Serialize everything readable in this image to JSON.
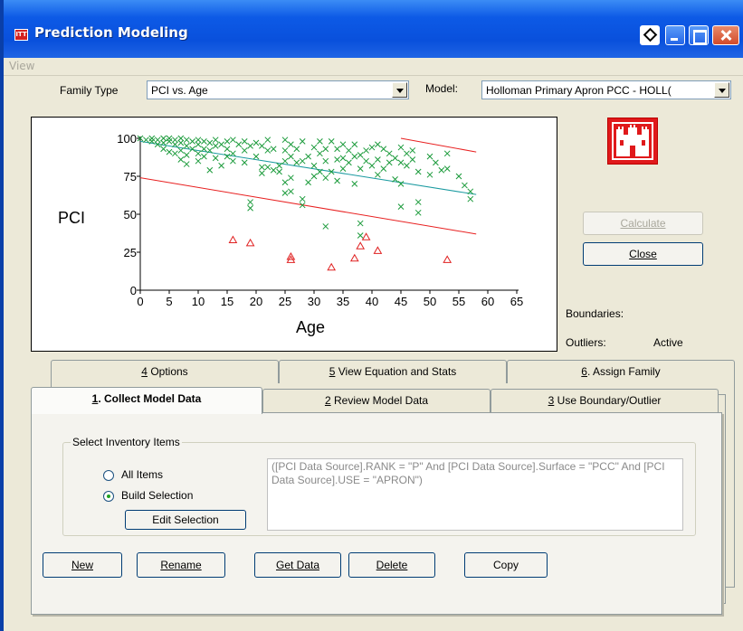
{
  "window": {
    "title": "Prediction Modeling"
  },
  "menu": {
    "view": "View"
  },
  "family": {
    "label": "Family Type",
    "value": "PCI vs. Age"
  },
  "model": {
    "label": "Model:",
    "value": "Holloman Primary Apron PCC - HOLL("
  },
  "buttons": {
    "calculate": "Calculate",
    "close": "Close",
    "edit_selection": "Edit Selection",
    "new": "New",
    "rename": "Rename",
    "get_data": "Get Data",
    "delete": "Delete",
    "copy": "Copy"
  },
  "status": {
    "boundaries_label": "Boundaries:",
    "outliers_label": "Outliers:",
    "outliers_value": "Active"
  },
  "tabs": {
    "back": [
      {
        "num": "4",
        "label": " Options"
      },
      {
        "num": "5",
        "label": " View Equation and Stats"
      },
      {
        "num": "6",
        "label": ". Assign Family"
      }
    ],
    "front": [
      {
        "num": "1",
        "label": ". Collect Model Data"
      },
      {
        "num": "2",
        "label": " Review Model Data"
      },
      {
        "num": "3",
        "label": " Use Boundary/Outlier"
      }
    ]
  },
  "inventory": {
    "legend": "Select Inventory Items",
    "option_all": "All Items",
    "option_build": "Build Selection",
    "query": "([PCI Data Source].RANK = \"P\" And [PCI Data Source].Surface = \"PCC\" And [PCI Data Source].USE = \"APRON\")"
  },
  "colors": {
    "title_blue": "#0950dc",
    "point_green": "#1a9a3a",
    "outlier_red": "#e02020",
    "fit_teal": "#1a9aa0",
    "boundary_red": "#e82020",
    "logo_red": "#e0191b"
  },
  "chart_data": {
    "type": "scatter",
    "xlabel": "Age",
    "ylabel": "PCI",
    "xlim": [
      0,
      65
    ],
    "ylim": [
      0,
      100
    ],
    "x_ticks": [
      0,
      5,
      10,
      15,
      20,
      25,
      30,
      35,
      40,
      45,
      50,
      55,
      60,
      65
    ],
    "y_ticks": [
      0,
      25,
      50,
      75,
      100
    ],
    "grid": false,
    "series": [
      {
        "marker": "x",
        "color": "#1a9a3a",
        "points": [
          [
            0,
            100
          ],
          [
            1,
            99
          ],
          [
            2,
            100
          ],
          [
            2,
            98
          ],
          [
            3,
            99
          ],
          [
            3,
            96
          ],
          [
            4,
            100
          ],
          [
            4,
            97
          ],
          [
            4,
            93
          ],
          [
            5,
            100
          ],
          [
            5,
            98
          ],
          [
            5,
            91
          ],
          [
            6,
            99
          ],
          [
            6,
            96
          ],
          [
            6,
            90
          ],
          [
            7,
            100
          ],
          [
            7,
            97
          ],
          [
            7,
            92
          ],
          [
            7,
            86
          ],
          [
            8,
            99
          ],
          [
            8,
            95
          ],
          [
            8,
            89
          ],
          [
            8,
            83
          ],
          [
            9,
            98
          ],
          [
            9,
            93
          ],
          [
            10,
            99
          ],
          [
            10,
            96
          ],
          [
            10,
            90
          ],
          [
            10,
            85
          ],
          [
            11,
            98
          ],
          [
            11,
            93
          ],
          [
            11,
            88
          ],
          [
            12,
            97
          ],
          [
            12,
            92
          ],
          [
            12,
            79
          ],
          [
            13,
            99
          ],
          [
            13,
            95
          ],
          [
            13,
            87
          ],
          [
            14,
            96
          ],
          [
            14,
            82
          ],
          [
            15,
            98
          ],
          [
            15,
            93
          ],
          [
            15,
            88
          ],
          [
            16,
            99
          ],
          [
            16,
            90
          ],
          [
            16,
            85
          ],
          [
            17,
            96
          ],
          [
            18,
            98
          ],
          [
            18,
            92
          ],
          [
            18,
            84
          ],
          [
            19,
            95
          ],
          [
            19,
            58
          ],
          [
            19,
            54
          ],
          [
            20,
            97
          ],
          [
            20,
            88
          ],
          [
            21,
            95
          ],
          [
            21,
            81
          ],
          [
            21,
            77
          ],
          [
            22,
            99
          ],
          [
            22,
            92
          ],
          [
            22,
            81
          ],
          [
            23,
            93
          ],
          [
            23,
            79
          ],
          [
            24,
            82
          ],
          [
            24,
            78
          ],
          [
            25,
            99
          ],
          [
            25,
            92
          ],
          [
            25,
            85
          ],
          [
            25,
            71
          ],
          [
            25,
            64
          ],
          [
            26,
            96
          ],
          [
            26,
            88
          ],
          [
            26,
            74
          ],
          [
            26,
            65
          ],
          [
            27,
            93
          ],
          [
            27,
            84
          ],
          [
            28,
            98
          ],
          [
            28,
            85
          ],
          [
            28,
            60
          ],
          [
            28,
            56
          ],
          [
            29,
            88
          ],
          [
            29,
            71
          ],
          [
            30,
            94
          ],
          [
            30,
            82
          ],
          [
            30,
            75
          ],
          [
            31,
            98
          ],
          [
            31,
            90
          ],
          [
            31,
            78
          ],
          [
            32,
            93
          ],
          [
            32,
            85
          ],
          [
            32,
            74
          ],
          [
            32,
            42
          ],
          [
            33,
            98
          ],
          [
            33,
            78
          ],
          [
            34,
            93
          ],
          [
            34,
            86
          ],
          [
            34,
            72
          ],
          [
            35,
            96
          ],
          [
            35,
            87
          ],
          [
            35,
            80
          ],
          [
            36,
            92
          ],
          [
            36,
            84
          ],
          [
            37,
            96
          ],
          [
            37,
            88
          ],
          [
            37,
            70
          ],
          [
            38,
            89
          ],
          [
            38,
            80
          ],
          [
            38,
            44
          ],
          [
            38,
            36
          ],
          [
            39,
            92
          ],
          [
            39,
            85
          ],
          [
            40,
            94
          ],
          [
            40,
            82
          ],
          [
            41,
            96
          ],
          [
            41,
            86
          ],
          [
            41,
            76
          ],
          [
            42,
            93
          ],
          [
            42,
            80
          ],
          [
            43,
            90
          ],
          [
            43,
            84
          ],
          [
            44,
            87
          ],
          [
            44,
            73
          ],
          [
            45,
            94
          ],
          [
            45,
            84
          ],
          [
            45,
            70
          ],
          [
            45,
            55
          ],
          [
            46,
            90
          ],
          [
            46,
            82
          ],
          [
            47,
            92
          ],
          [
            47,
            86
          ],
          [
            48,
            78
          ],
          [
            48,
            58
          ],
          [
            48,
            51
          ],
          [
            50,
            88
          ],
          [
            50,
            76
          ],
          [
            51,
            84
          ],
          [
            52,
            79
          ],
          [
            53,
            90
          ],
          [
            53,
            80
          ],
          [
            55,
            75
          ],
          [
            56,
            69
          ],
          [
            57,
            65
          ],
          [
            57,
            60
          ]
        ]
      },
      {
        "marker": "triangle",
        "color": "#e02020",
        "points": [
          [
            16,
            33
          ],
          [
            19,
            31
          ],
          [
            26,
            22
          ],
          [
            26,
            20
          ],
          [
            33,
            15
          ],
          [
            37,
            21
          ],
          [
            38,
            29
          ],
          [
            39,
            35
          ],
          [
            41,
            26
          ],
          [
            53,
            20
          ]
        ]
      }
    ],
    "lines": [
      {
        "color": "#1a9aa0",
        "from": [
          0,
          98
        ],
        "to": [
          58,
          63
        ]
      },
      {
        "color": "#e82020",
        "from": [
          0,
          74
        ],
        "to": [
          58,
          37
        ]
      },
      {
        "color": "#e82020",
        "from": [
          45,
          100
        ],
        "to": [
          58,
          91
        ]
      }
    ]
  }
}
